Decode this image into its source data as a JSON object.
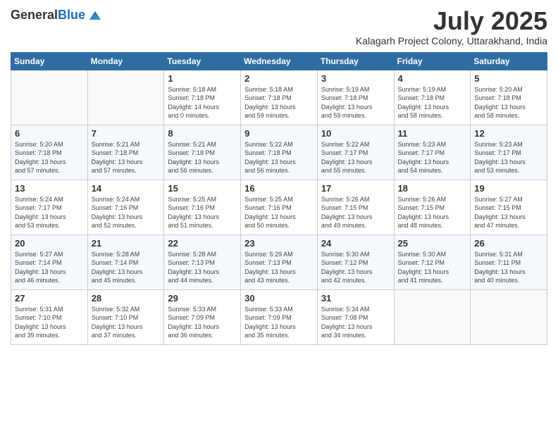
{
  "header": {
    "logo_general": "General",
    "logo_blue": "Blue",
    "title": "July 2025",
    "subtitle": "Kalagarh Project Colony, Uttarakhand, India"
  },
  "days_of_week": [
    "Sunday",
    "Monday",
    "Tuesday",
    "Wednesday",
    "Thursday",
    "Friday",
    "Saturday"
  ],
  "weeks": [
    [
      {
        "day": "",
        "info": ""
      },
      {
        "day": "",
        "info": ""
      },
      {
        "day": "1",
        "info": "Sunrise: 5:18 AM\nSunset: 7:18 PM\nDaylight: 14 hours\nand 0 minutes."
      },
      {
        "day": "2",
        "info": "Sunrise: 5:18 AM\nSunset: 7:18 PM\nDaylight: 13 hours\nand 59 minutes."
      },
      {
        "day": "3",
        "info": "Sunrise: 5:19 AM\nSunset: 7:18 PM\nDaylight: 13 hours\nand 59 minutes."
      },
      {
        "day": "4",
        "info": "Sunrise: 5:19 AM\nSunset: 7:18 PM\nDaylight: 13 hours\nand 58 minutes."
      },
      {
        "day": "5",
        "info": "Sunrise: 5:20 AM\nSunset: 7:18 PM\nDaylight: 13 hours\nand 58 minutes."
      }
    ],
    [
      {
        "day": "6",
        "info": "Sunrise: 5:20 AM\nSunset: 7:18 PM\nDaylight: 13 hours\nand 57 minutes."
      },
      {
        "day": "7",
        "info": "Sunrise: 5:21 AM\nSunset: 7:18 PM\nDaylight: 13 hours\nand 57 minutes."
      },
      {
        "day": "8",
        "info": "Sunrise: 5:21 AM\nSunset: 7:18 PM\nDaylight: 13 hours\nand 56 minutes."
      },
      {
        "day": "9",
        "info": "Sunrise: 5:22 AM\nSunset: 7:18 PM\nDaylight: 13 hours\nand 56 minutes."
      },
      {
        "day": "10",
        "info": "Sunrise: 5:22 AM\nSunset: 7:17 PM\nDaylight: 13 hours\nand 55 minutes."
      },
      {
        "day": "11",
        "info": "Sunrise: 5:23 AM\nSunset: 7:17 PM\nDaylight: 13 hours\nand 54 minutes."
      },
      {
        "day": "12",
        "info": "Sunrise: 5:23 AM\nSunset: 7:17 PM\nDaylight: 13 hours\nand 53 minutes."
      }
    ],
    [
      {
        "day": "13",
        "info": "Sunrise: 5:24 AM\nSunset: 7:17 PM\nDaylight: 13 hours\nand 53 minutes."
      },
      {
        "day": "14",
        "info": "Sunrise: 5:24 AM\nSunset: 7:16 PM\nDaylight: 13 hours\nand 52 minutes."
      },
      {
        "day": "15",
        "info": "Sunrise: 5:25 AM\nSunset: 7:16 PM\nDaylight: 13 hours\nand 51 minutes."
      },
      {
        "day": "16",
        "info": "Sunrise: 5:25 AM\nSunset: 7:16 PM\nDaylight: 13 hours\nand 50 minutes."
      },
      {
        "day": "17",
        "info": "Sunrise: 5:26 AM\nSunset: 7:15 PM\nDaylight: 13 hours\nand 49 minutes."
      },
      {
        "day": "18",
        "info": "Sunrise: 5:26 AM\nSunset: 7:15 PM\nDaylight: 13 hours\nand 48 minutes."
      },
      {
        "day": "19",
        "info": "Sunrise: 5:27 AM\nSunset: 7:15 PM\nDaylight: 13 hours\nand 47 minutes."
      }
    ],
    [
      {
        "day": "20",
        "info": "Sunrise: 5:27 AM\nSunset: 7:14 PM\nDaylight: 13 hours\nand 46 minutes."
      },
      {
        "day": "21",
        "info": "Sunrise: 5:28 AM\nSunset: 7:14 PM\nDaylight: 13 hours\nand 45 minutes."
      },
      {
        "day": "22",
        "info": "Sunrise: 5:28 AM\nSunset: 7:13 PM\nDaylight: 13 hours\nand 44 minutes."
      },
      {
        "day": "23",
        "info": "Sunrise: 5:29 AM\nSunset: 7:13 PM\nDaylight: 13 hours\nand 43 minutes."
      },
      {
        "day": "24",
        "info": "Sunrise: 5:30 AM\nSunset: 7:12 PM\nDaylight: 13 hours\nand 42 minutes."
      },
      {
        "day": "25",
        "info": "Sunrise: 5:30 AM\nSunset: 7:12 PM\nDaylight: 13 hours\nand 41 minutes."
      },
      {
        "day": "26",
        "info": "Sunrise: 5:31 AM\nSunset: 7:11 PM\nDaylight: 13 hours\nand 40 minutes."
      }
    ],
    [
      {
        "day": "27",
        "info": "Sunrise: 5:31 AM\nSunset: 7:10 PM\nDaylight: 13 hours\nand 39 minutes."
      },
      {
        "day": "28",
        "info": "Sunrise: 5:32 AM\nSunset: 7:10 PM\nDaylight: 13 hours\nand 37 minutes."
      },
      {
        "day": "29",
        "info": "Sunrise: 5:33 AM\nSunset: 7:09 PM\nDaylight: 13 hours\nand 36 minutes."
      },
      {
        "day": "30",
        "info": "Sunrise: 5:33 AM\nSunset: 7:09 PM\nDaylight: 13 hours\nand 35 minutes."
      },
      {
        "day": "31",
        "info": "Sunrise: 5:34 AM\nSunset: 7:08 PM\nDaylight: 13 hours\nand 34 minutes."
      },
      {
        "day": "",
        "info": ""
      },
      {
        "day": "",
        "info": ""
      }
    ]
  ]
}
